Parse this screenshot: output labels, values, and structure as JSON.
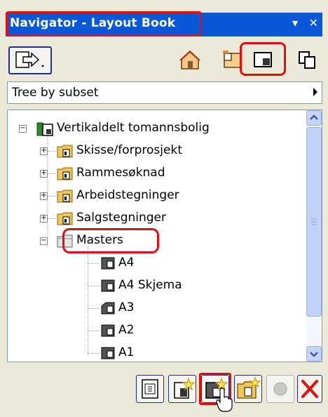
{
  "window": {
    "title": "Navigator - Layout Book",
    "controls": [
      "pin-icon",
      "close-icon"
    ]
  },
  "toolbar": {
    "buttons": [
      "export-icon",
      "project-map-icon",
      "view-map-icon",
      "layout-book-icon",
      "publisher-icon"
    ],
    "active": "layout-book-icon"
  },
  "view_selector": {
    "value": "Tree by subset"
  },
  "tree": {
    "root": "Vertikaldelt tomannsbolig",
    "subsets": [
      "Skisse/forprosjekt",
      "Rammesøknad",
      "Arbeidstegninger",
      "Salgstegninger"
    ],
    "masters_label": "Masters",
    "masters": [
      "A4",
      "A4 Skjema",
      "A3",
      "A2",
      "A1"
    ]
  },
  "bottom_bar": {
    "buttons": [
      "settings-icon",
      "new-master-icon",
      "new-master-layout-icon",
      "new-subset-icon",
      "disabled-icon",
      "delete-icon"
    ],
    "active": "new-master-layout-icon"
  },
  "colors": {
    "title_bar": "#0a58d8",
    "highlight": "#e01010",
    "window_bg": "#ece9d8"
  }
}
